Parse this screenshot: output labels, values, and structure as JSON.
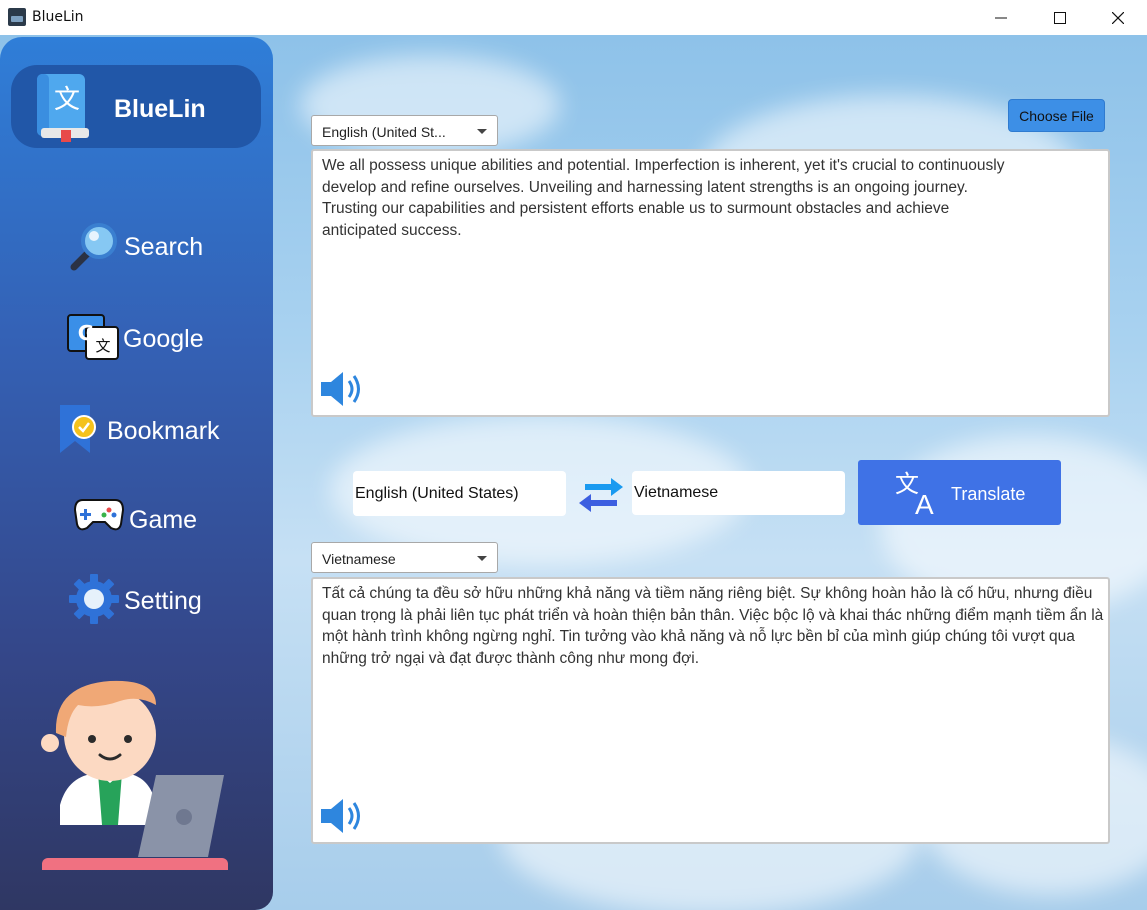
{
  "window": {
    "title": "BlueLin",
    "controls": {
      "minimize": "minimize-icon",
      "maximize": "maximize-icon",
      "close": "close-icon"
    }
  },
  "sidebar": {
    "brand": "BlueLin",
    "items": [
      {
        "label": "Search",
        "icon": "magnifier-icon"
      },
      {
        "label": "Google",
        "icon": "google-translate-icon"
      },
      {
        "label": "Bookmark",
        "icon": "bookmark-icon"
      },
      {
        "label": "Game",
        "icon": "gamepad-icon"
      },
      {
        "label": "Setting",
        "icon": "gear-icon"
      }
    ]
  },
  "source": {
    "language": "English (United St...",
    "choose_file": "Choose File",
    "text": "We all possess unique abilities and potential. Imperfection is inherent, yet it's crucial to continuously develop and refine ourselves. Unveiling and harnessing latent strengths is an ongoing journey. Trusting our capabilities and persistent efforts enable us to surmount obstacles and achieve anticipated success."
  },
  "translator": {
    "from": "English (United States)",
    "to": "Vietnamese",
    "button": "Translate"
  },
  "target": {
    "language": "Vietnamese",
    "text": "Tất cả chúng ta đều sở hữu những khả năng và tiềm năng riêng biệt. Sự không hoàn hảo là cố hữu, nhưng điều quan trọng là phải liên tục phát triển và hoàn thiện bản thân. Việc bộc lộ và khai thác những điểm mạnh tiềm ẩn là một hành trình không ngừng nghỉ. Tin tưởng vào khả năng và nỗ lực bền bỉ của mình giúp chúng tôi vượt qua những trở ngại và đạt được thành công như mong đợi."
  },
  "colors": {
    "accent": "#3f72e6",
    "sidebar_top": "#2f7ed8",
    "sidebar_bottom": "#2f3763"
  }
}
